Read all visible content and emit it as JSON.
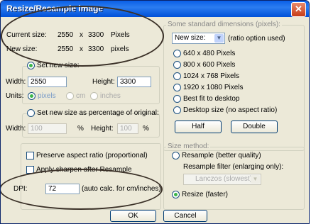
{
  "window": {
    "title": "Resize/Resample image",
    "close_label": "✕"
  },
  "current": {
    "label": "Current size:",
    "width": "2550",
    "x": "x",
    "height": "3300",
    "unit": "Pixels"
  },
  "newsize": {
    "label": "New size:",
    "width": "2550",
    "x": "x",
    "height": "3300",
    "unit": "pixels"
  },
  "setsize": {
    "label": "Set new size:",
    "width_label": "Width:",
    "width_value": "2550",
    "height_label": "Height:",
    "height_value": "3300",
    "units_label": "Units:",
    "units": [
      "pixels",
      "cm",
      "inches"
    ]
  },
  "percent": {
    "label": "Set new size as percentage of original:",
    "width_label": "Width:",
    "width_value": "100",
    "pct1": "%",
    "height_label": "Height:",
    "height_value": "100",
    "pct2": "%"
  },
  "standard": {
    "legend": "Some standard dimensions (pixels):",
    "dropdown_value": "New size:",
    "ratio_note": "(ratio option used)",
    "options": [
      "640 x 480 Pixels",
      "800 x 600 Pixels",
      "1024 x 768 Pixels",
      "1920 x 1080 Pixels",
      "Best fit to desktop",
      "Desktop size (no aspect ratio)"
    ],
    "half_label": "Half",
    "double_label": "Double"
  },
  "options": {
    "preserve_label": "Preserve aspect ratio (proportional)",
    "sharpen_label": "Apply sharpen after Resample",
    "dpi_label": "DPI:",
    "dpi_value": "72",
    "dpi_note": "(auto calc. for cm/inches)"
  },
  "method": {
    "legend": "Size method:",
    "resample_label": "Resample (better quality)",
    "filter_label": "Resample filter (enlarging only):",
    "filter_value": "Lanczos (slowest)",
    "resize_label": "Resize (faster)"
  },
  "footer": {
    "ok_label": "OK",
    "cancel_label": "Cancel"
  }
}
